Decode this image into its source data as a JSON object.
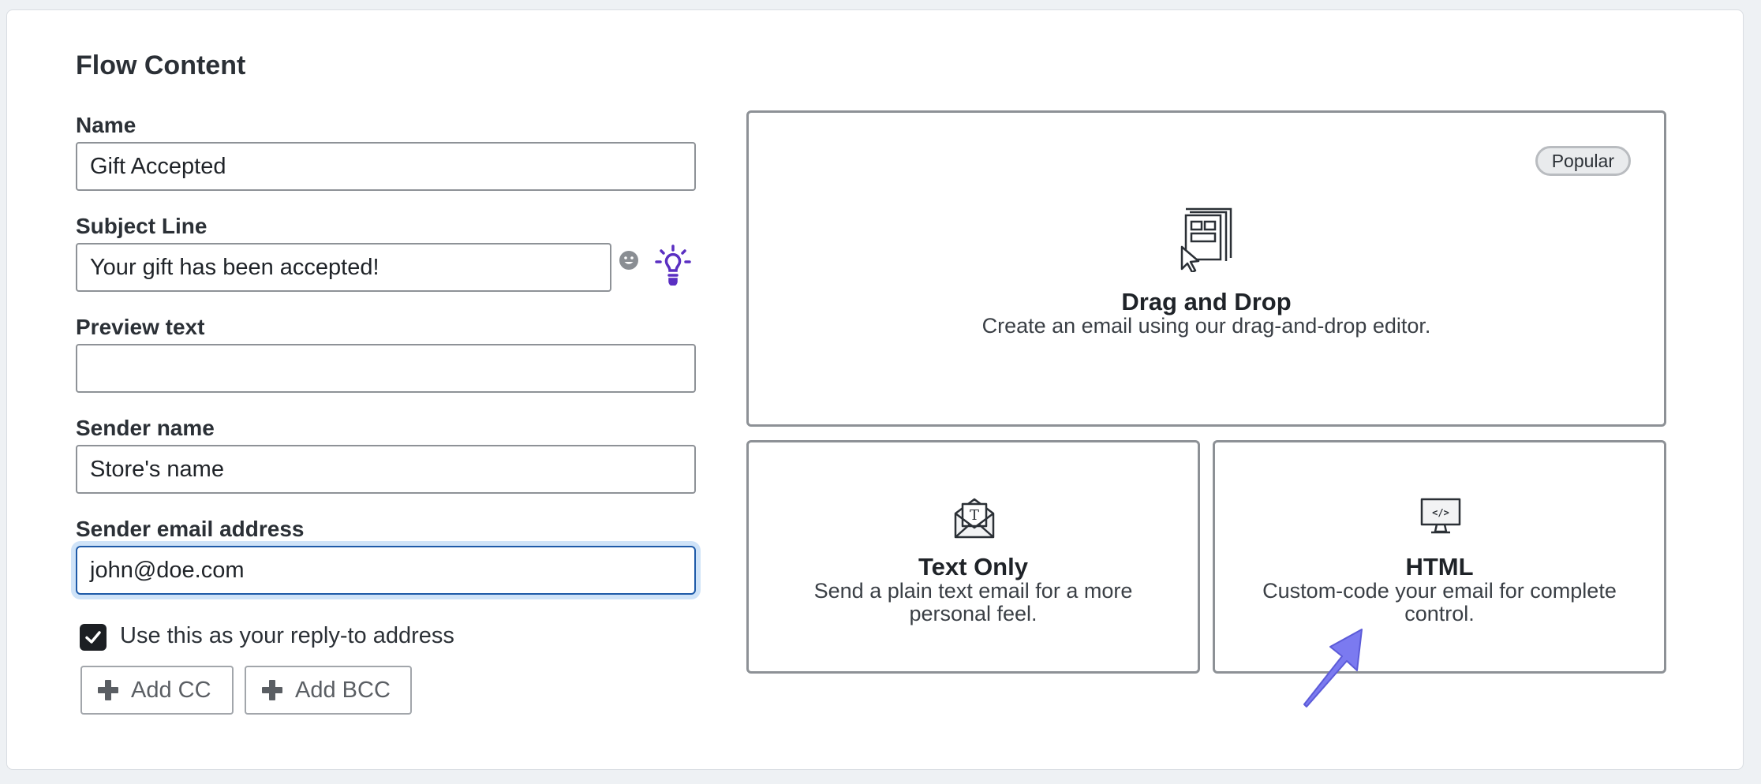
{
  "section": {
    "title": "Flow Content"
  },
  "form": {
    "name": {
      "label": "Name",
      "value": "Gift Accepted"
    },
    "subject": {
      "label": "Subject Line",
      "value": "Your gift has been accepted!"
    },
    "preview": {
      "label": "Preview text",
      "value": "",
      "placeholder": ""
    },
    "sender_name": {
      "label": "Sender name",
      "value": "Store's name"
    },
    "sender_email": {
      "label": "Sender email address",
      "value": "john@doe.com"
    },
    "reply_to": {
      "label": "Use this as your reply-to address",
      "checked": true
    },
    "add_cc": "Add CC",
    "add_bcc": "Add BCC"
  },
  "icons": {
    "emoji": "smiley-face-icon",
    "bulb": "lightbulb-icon",
    "plus": "plus-icon",
    "check": "checkmark-icon"
  },
  "editors": {
    "drag_drop": {
      "badge": "Popular",
      "title": "Drag and Drop",
      "description": "Create an email using our drag-and-drop editor."
    },
    "text_only": {
      "title": "Text Only",
      "description": "Send a plain text email for a more personal feel."
    },
    "html": {
      "title": "HTML",
      "description": "Custom-code your email for complete control.",
      "icon_text": "</>"
    }
  },
  "colors": {
    "accent": "#5a2fc2",
    "focus": "#1e5aa8",
    "focus_ring": "#cfe3f8",
    "pointer": "#6f6ee8"
  }
}
